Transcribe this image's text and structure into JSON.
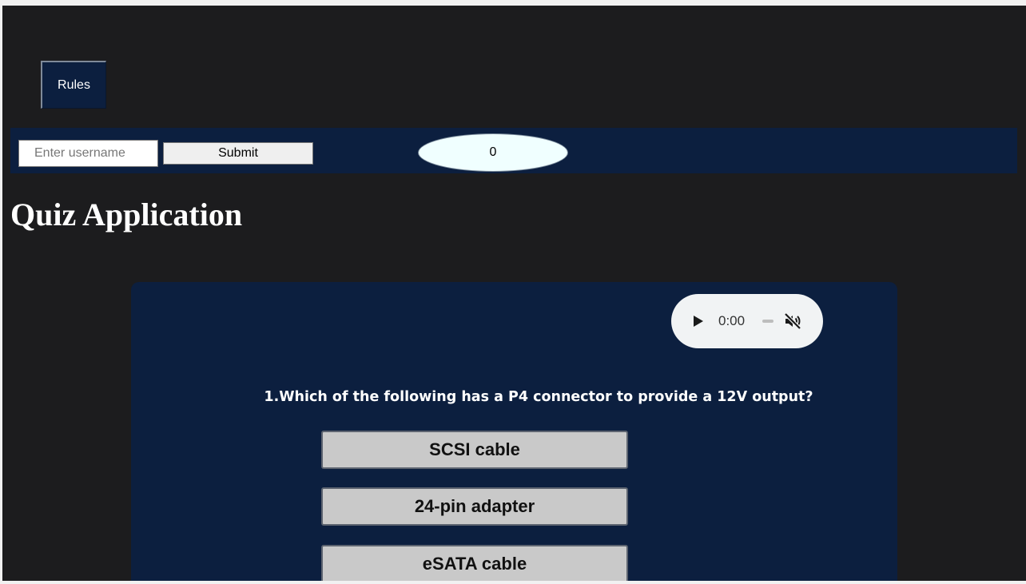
{
  "header": {
    "rules_label": "Rules"
  },
  "topbar": {
    "username_placeholder": "Enter username",
    "submit_label": "Submit",
    "score": "0"
  },
  "page": {
    "title": "Quiz Application"
  },
  "audio": {
    "time": "0:00",
    "play_icon": "play-icon",
    "mute_icon": "muted-speaker-icon"
  },
  "quiz": {
    "question": "1.Which of the following has a P4 connector to provide a 12V output?",
    "options": [
      {
        "label": "SCSI cable"
      },
      {
        "label": "24-pin adapter"
      },
      {
        "label": "eSATA cable"
      }
    ]
  },
  "colors": {
    "background": "#1c1c1e",
    "panel": "#0c1f3f",
    "score_oval": "#f0ffff",
    "option_button": "#c9c9c9",
    "text_light": "#ffffff"
  }
}
